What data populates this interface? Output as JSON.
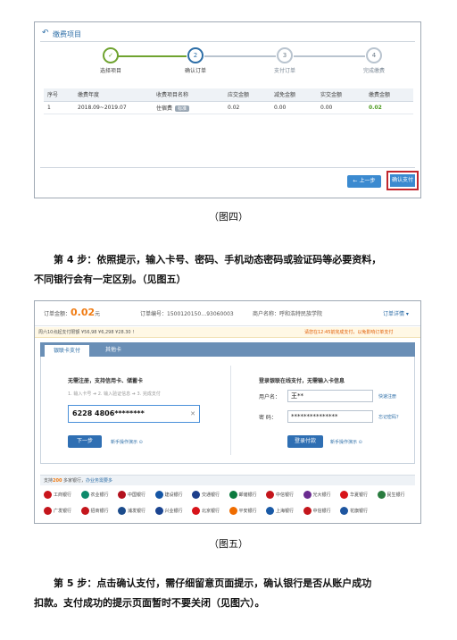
{
  "figure4": {
    "header_title": "缴费项目",
    "steps": [
      {
        "number": "✓",
        "label": "选择项目",
        "state": "done"
      },
      {
        "number": "2",
        "label": "确认订单",
        "state": "current"
      },
      {
        "number": "3",
        "label": "支付订单",
        "state": "todo"
      },
      {
        "number": "4",
        "label": "完成缴费",
        "state": "todo"
      }
    ],
    "table": {
      "headers": [
        "序号",
        "缴费年度",
        "收费项目名称",
        "应交金额",
        "减免金额",
        "实交金额",
        "缴费金额"
      ],
      "rows": [
        {
          "seq": "1",
          "year": "2018.09~2019.07",
          "item": "住宿费",
          "tag": "标准",
          "due": "0.02",
          "reduce": "0.00",
          "paid": "0.00",
          "pay": "0.02"
        }
      ]
    },
    "prev_button": "← 上一步",
    "confirm_button": "确认支付",
    "caption": "（图四）"
  },
  "step4_text": {
    "line1": "第 4 步：依照提示，输入卡号、密码、手机动态密码或验证码等必要资料，",
    "line2": "不同银行会有一定区别。（见图五）"
  },
  "figure5": {
    "order_amount_label": "订单金额：",
    "order_amount": "0.02",
    "order_amount_unit": "元",
    "order_no_label": "订单编号：",
    "order_no": "1500120150…93060003",
    "merchant_label": "商户名称：",
    "merchant": "呼和浩特民族学院",
    "order_detail_link": "订单详情 ▾",
    "notice_left": "周六10点起支付限额 ¥56,98 ¥6,298 ¥28.30 !",
    "notice_right": "请您在12:45前完成支付，以免影响订单支付",
    "tabs": [
      "银联卡支付",
      "其他卡"
    ],
    "left": {
      "title": "无需注册，支持信用卡、储蓄卡",
      "steps": "1. 输入卡号  ➔  2. 输入验证信息  ➔  3. 完成支付",
      "card_number": "6228 4806********",
      "clear": "✕",
      "next_button": "下一步",
      "guide_link": "新手操作演示 ⊙"
    },
    "right": {
      "title": "登录银联在线支付，无需输入卡信息",
      "username_label": "用户名：",
      "username_value": "王**",
      "register_link": "快速注册",
      "password_label": "密    码：",
      "password_value": "***************",
      "forgot_link": "忘记密码？",
      "login_button": "登录付款",
      "guide_link": "新手操作演示 ⊙"
    },
    "banks_header": {
      "prefix": "支持",
      "count": "200",
      "suffix": " 多家银行，",
      "link": "办业务需要多"
    },
    "banks": [
      {
        "name": "工商银行",
        "color": "#c9141b"
      },
      {
        "name": "农业银行",
        "color": "#0d8a6b"
      },
      {
        "name": "中国银行",
        "color": "#b3111d"
      },
      {
        "name": "建设银行",
        "color": "#1556a5"
      },
      {
        "name": "交通银行",
        "color": "#1d3f8b"
      },
      {
        "name": "邮储银行",
        "color": "#0b7a3e"
      },
      {
        "name": "中信银行",
        "color": "#c4161c"
      },
      {
        "name": "光大银行",
        "color": "#6b2c90"
      },
      {
        "name": "华夏银行",
        "color": "#d7141a"
      },
      {
        "name": "民生银行",
        "color": "#2a7c3f"
      },
      {
        "name": "广发银行",
        "color": "#c4161c"
      },
      {
        "name": "招商银行",
        "color": "#c4161c"
      },
      {
        "name": "浦发银行",
        "color": "#1c4c8c"
      },
      {
        "name": "兴业银行",
        "color": "#1b4591"
      },
      {
        "name": "北京银行",
        "color": "#d7141a"
      },
      {
        "name": "平安银行",
        "color": "#ef6c00"
      },
      {
        "name": "上海银行",
        "color": "#1a5aa6"
      },
      {
        "name": "中信银行",
        "color": "#c4161c"
      },
      {
        "name": "花旗银行",
        "color": "#1e56a0"
      }
    ],
    "caption": "（图五）"
  },
  "step5_text": {
    "line1": "第 5 步：点击确认支付，需仔细留意页面提示，确认银行是否从账户成功",
    "line2": "扣款。支付成功的提示页面暂时不要关闭（见图六）。"
  }
}
